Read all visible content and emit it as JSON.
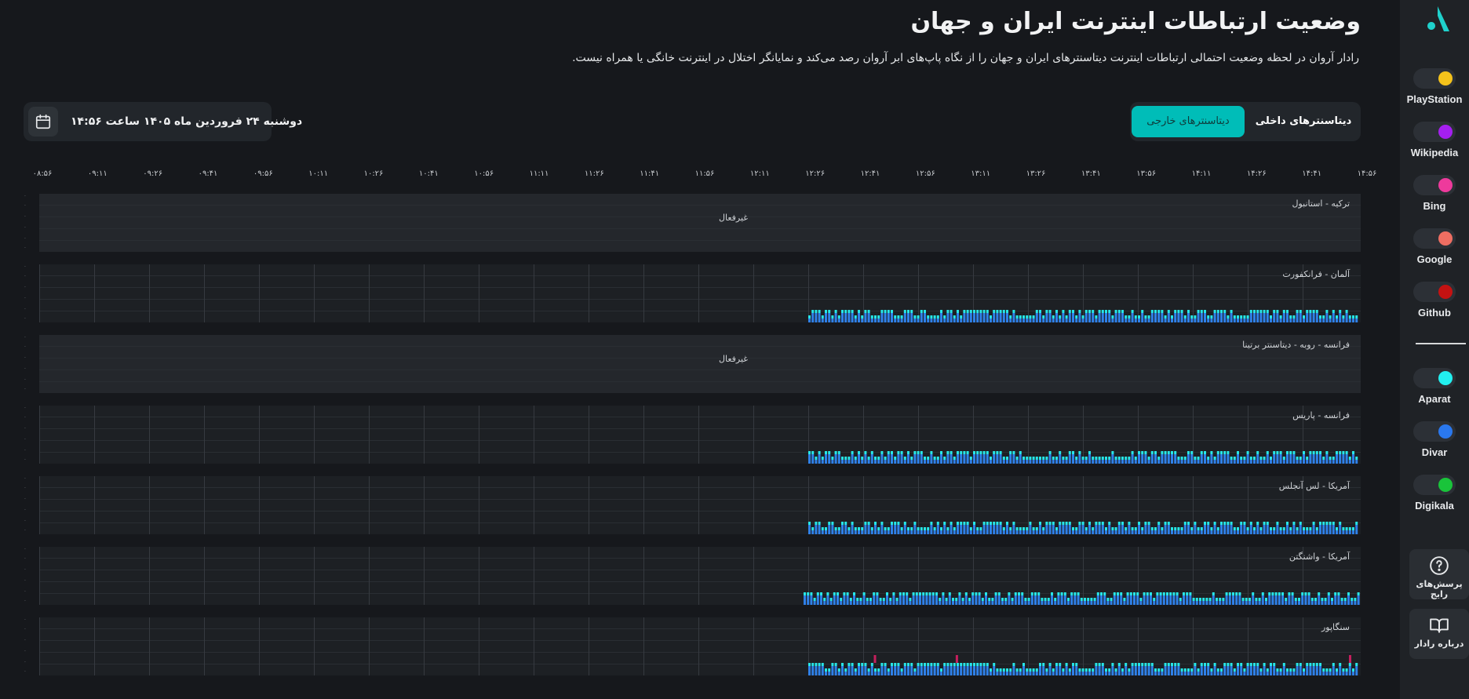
{
  "header": {
    "title": "وضعیت ارتباطات اینترنت ایران و جهان",
    "subtitle": "رادار آروان در لحظه وضعیت احتمالی ارتباطات اینترنت دیتاسنترهای ایران و جهان را از نگاه پاپ‌های ابر آروان رصد می‌کند و نمایانگر اختلال در اینترنت خانگی یا همراه نیست."
  },
  "tabs": {
    "domestic": "دیتاسنترهای داخلی",
    "foreign": "دیتاسنترهای خارجی",
    "active": "foreign"
  },
  "date": {
    "text": "دوشنبه ۲۴ فروردین ماه ۱۴۰۵ ساعت ۱۴:۵۶",
    "icon": "calendar-icon"
  },
  "time_axis": [
    "۰۸:۵۶",
    "۰۹:۱۱",
    "۰۹:۲۶",
    "۰۹:۴۱",
    "۰۹:۵۶",
    "۱۰:۱۱",
    "۱۰:۲۶",
    "۱۰:۴۱",
    "۱۰:۵۶",
    "۱۱:۱۱",
    "۱۱:۲۶",
    "۱۱:۴۱",
    "۱۱:۵۶",
    "۱۲:۱۱",
    "۱۲:۲۶",
    "۱۲:۴۱",
    "۱۲:۵۶",
    "۱۳:۱۱",
    "۱۳:۲۶",
    "۱۳:۴۱",
    "۱۳:۵۶",
    "۱۴:۱۱",
    "۱۴:۲۶",
    "۱۴:۴۱",
    "۱۴:۵۶"
  ],
  "colors": {
    "bar_main": "#2f80e8",
    "bar_top": "#26e6e6",
    "bar_alert": "#c51f5d",
    "accent": "#00bdb8"
  },
  "rows": [
    {
      "label": "ترکیه - استانبول",
      "status": "غیرفعال",
      "active": false,
      "alerts": []
    },
    {
      "label": "آلمان - فرانکفورت",
      "status": "",
      "active": true,
      "alerts": []
    },
    {
      "label": "فرانسه - روبه - دیتاسنتر برتینا",
      "status": "غیرفعال",
      "active": false,
      "alerts": []
    },
    {
      "label": "فرانسه - پاریس",
      "status": "",
      "active": true,
      "alerts": []
    },
    {
      "label": "آمریکا - لس آنجلس",
      "status": "",
      "active": true,
      "alerts": []
    },
    {
      "label": "آمریکا - واشنگتن",
      "status": "",
      "active": true,
      "alerts": []
    },
    {
      "label": "سنگاپور",
      "status": "",
      "active": true,
      "alerts": [
        0.12,
        0.27,
        0.99
      ]
    }
  ],
  "sidebar": {
    "logo": "arvan-logo",
    "services_top": [
      {
        "name": "PlayStation",
        "color": "#f4c21b"
      },
      {
        "name": "Wikipedia",
        "color": "#a51ff0"
      },
      {
        "name": "Bing",
        "color": "#ee3a9c"
      },
      {
        "name": "Google",
        "color": "#ee6e62"
      },
      {
        "name": "Github",
        "color": "#c41212"
      }
    ],
    "services_bottom": [
      {
        "name": "Aparat",
        "color": "#22f0f0"
      },
      {
        "name": "Divar",
        "color": "#2a78ee"
      },
      {
        "name": "Digikala",
        "color": "#19c43a"
      }
    ],
    "faq": "پرسش‌های رایج",
    "about": "درباره رادار"
  }
}
